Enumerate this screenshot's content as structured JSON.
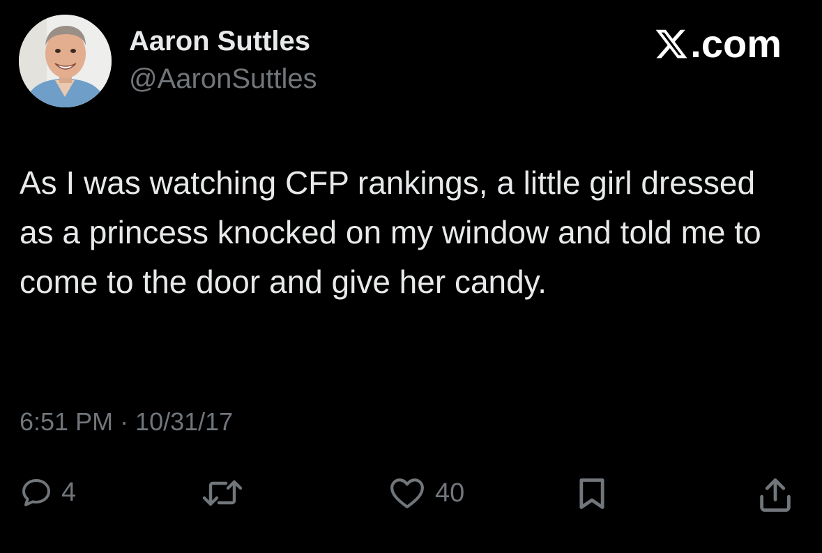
{
  "author": {
    "display_name": "Aaron Suttles",
    "handle": "@AaronSuttles"
  },
  "brand": {
    "logo_icon": "x-logo-icon",
    "suffix": ".com"
  },
  "tweet": {
    "text": "As I was watching CFP rankings, a little girl dressed as a princess knocked on my window and told me to come to the door and give her candy.",
    "timestamp": "6:51 PM · 10/31/17"
  },
  "actions": {
    "reply": {
      "icon": "reply-icon",
      "count": "4"
    },
    "retweet": {
      "icon": "retweet-icon",
      "count": ""
    },
    "like": {
      "icon": "heart-icon",
      "count": "40"
    },
    "bookmark": {
      "icon": "bookmark-icon"
    },
    "share": {
      "icon": "share-icon"
    }
  },
  "colors": {
    "background": "#000000",
    "primary_text": "#e7e9ea",
    "secondary_text": "#71767b"
  }
}
